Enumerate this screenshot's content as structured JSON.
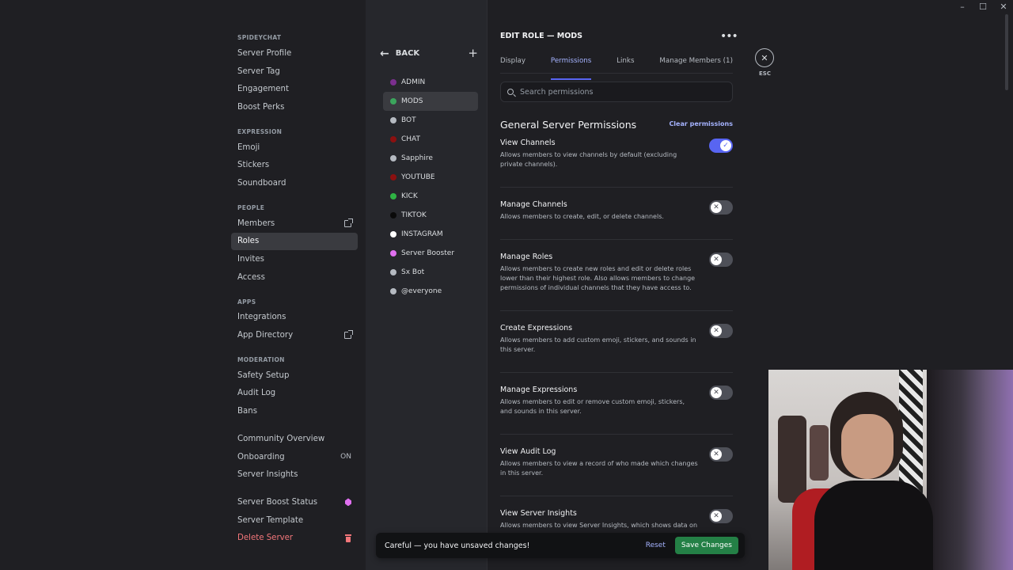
{
  "window_controls": {
    "minimize": "–",
    "maximize": "☐",
    "close": "✕"
  },
  "nav": {
    "server_name": "SPIDEYCHAT",
    "group1": [
      "Server Profile",
      "Server Tag",
      "Engagement",
      "Boost Perks"
    ],
    "expression_head": "EXPRESSION",
    "expression": [
      "Emoji",
      "Stickers",
      "Soundboard"
    ],
    "people_head": "PEOPLE",
    "members": "Members",
    "roles": "Roles",
    "invites": "Invites",
    "access": "Access",
    "apps_head": "APPS",
    "integrations": "Integrations",
    "app_directory": "App Directory",
    "moderation_head": "MODERATION",
    "moderation": [
      "Safety Setup",
      "Audit Log",
      "Bans"
    ],
    "community_overview": "Community Overview",
    "onboarding": "Onboarding",
    "onboarding_status": "ON",
    "server_insights": "Server Insights",
    "server_boost_status": "Server Boost Status",
    "server_template": "Server Template",
    "delete_server": "Delete Server"
  },
  "roles_panel": {
    "back_label": "BACK",
    "roles": [
      {
        "name": "ADMIN",
        "color": "#7b2f8f"
      },
      {
        "name": "MODS",
        "color": "#3ba55c"
      },
      {
        "name": "BOT",
        "color": "#b5bac1"
      },
      {
        "name": "CHAT",
        "color": "#8b1010"
      },
      {
        "name": "Sapphire",
        "color": "#b5bac1"
      },
      {
        "name": "YOUTUBE",
        "color": "#8b1010"
      },
      {
        "name": "KICK",
        "color": "#2fb344"
      },
      {
        "name": "TIKTOK",
        "color": "#0a0a0a"
      },
      {
        "name": "INSTAGRAM",
        "color": "#ffffff"
      },
      {
        "name": "Server Booster",
        "color": "#e070f0"
      },
      {
        "name": "Sx Bot",
        "color": "#b5bac1"
      },
      {
        "name": "@everyone",
        "color": "#b5bac1"
      }
    ]
  },
  "editor": {
    "title": "EDIT ROLE — MODS",
    "tabs": [
      "Display",
      "Permissions",
      "Links",
      "Manage Members (1)"
    ],
    "search_placeholder": "Search permissions",
    "section_title": "General Server Permissions",
    "clear_label": "Clear permissions",
    "permissions": [
      {
        "name": "View Channels",
        "desc": "Allows members to view channels by default (excluding private channels).",
        "enabled": true
      },
      {
        "name": "Manage Channels",
        "desc": "Allows members to create, edit, or delete channels.",
        "enabled": false
      },
      {
        "name": "Manage Roles",
        "desc": "Allows members to create new roles and edit or delete roles lower than their highest role. Also allows members to change permissions of individual channels that they have access to.",
        "enabled": false
      },
      {
        "name": "Create Expressions",
        "desc": "Allows members to add custom emoji, stickers, and sounds in this server.",
        "enabled": false
      },
      {
        "name": "Manage Expressions",
        "desc": "Allows members to edit or remove custom emoji, stickers, and sounds in this server.",
        "enabled": false
      },
      {
        "name": "View Audit Log",
        "desc": "Allows members to view a record of who made which changes in this server.",
        "enabled": false
      },
      {
        "name": "View Server Insights",
        "desc": "Allows members to view Server Insights, which shows data on",
        "enabled": false
      }
    ]
  },
  "esc": {
    "label": "ESC",
    "icon": "✕"
  },
  "notice": {
    "text": "Careful — you have unsaved changes!",
    "reset": "Reset",
    "save": "Save Changes"
  },
  "colors": {
    "accent": "#5865f2",
    "save_green": "#248046",
    "danger": "#f2767a"
  }
}
